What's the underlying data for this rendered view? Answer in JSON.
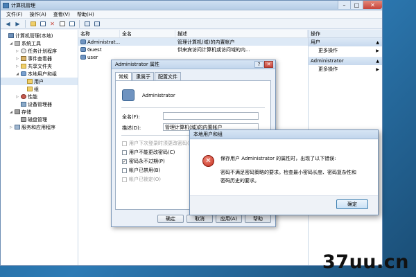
{
  "window": {
    "title": "计算机管理",
    "controls": {
      "min": "–",
      "max": "□",
      "close": "✕"
    }
  },
  "menu": [
    "文件(F)",
    "操作(A)",
    "查看(V)",
    "帮助(H)"
  ],
  "toolbar": {
    "back": "◀",
    "forward": "▶",
    "delete": "✕"
  },
  "tree": [
    {
      "label": "计算机管理(本地)",
      "indent": 0,
      "icon": "computer-icon",
      "exp": ""
    },
    {
      "label": "系统工具",
      "indent": 1,
      "icon": "tools-icon",
      "exp": "◢"
    },
    {
      "label": "任务计划程序",
      "indent": 2,
      "icon": "clock-icon",
      "exp": "▷"
    },
    {
      "label": "事件查看器",
      "indent": 2,
      "icon": "log-icon",
      "exp": "▷"
    },
    {
      "label": "共享文件夹",
      "indent": 2,
      "icon": "folder-icon",
      "exp": "▷"
    },
    {
      "label": "本地用户和组",
      "indent": 2,
      "icon": "users-icon",
      "exp": "◢"
    },
    {
      "label": "用户",
      "indent": 3,
      "icon": "folder-icon",
      "exp": ""
    },
    {
      "label": "组",
      "indent": 3,
      "icon": "folder-icon",
      "exp": ""
    },
    {
      "label": "性能",
      "indent": 2,
      "icon": "performance-icon",
      "exp": "▷"
    },
    {
      "label": "设备管理器",
      "indent": 2,
      "icon": "device-icon",
      "exp": ""
    },
    {
      "label": "存储",
      "indent": 1,
      "icon": "storage-icon",
      "exp": "◢"
    },
    {
      "label": "磁盘管理",
      "indent": 2,
      "icon": "disk-icon",
      "exp": ""
    },
    {
      "label": "服务和应用程序",
      "indent": 1,
      "icon": "services-icon",
      "exp": "▷"
    }
  ],
  "list": {
    "columns": [
      "名称",
      "全名",
      "描述"
    ],
    "rows": [
      {
        "name": "Administrat...",
        "fullname": "",
        "desc": "管理计算机(域)的内置帐户"
      },
      {
        "name": "Guest",
        "fullname": "",
        "desc": "供来宾访问计算机或访问域的内..."
      },
      {
        "name": "user",
        "fullname": "",
        "desc": ""
      }
    ]
  },
  "actions": {
    "header": "操作",
    "groups": [
      {
        "title": "用户",
        "item": "更多操作"
      },
      {
        "title": "Administrator",
        "item": "更多操作"
      }
    ]
  },
  "props_dialog": {
    "title": "Administrator 属性",
    "controls": {
      "help": "?",
      "close": "✕"
    },
    "tabs": [
      "常规",
      "隶属于",
      "配置文件"
    ],
    "username": "Administrator",
    "fullname_label": "全名(F):",
    "fullname_value": "",
    "desc_label": "描述(D):",
    "desc_value": "管理计算机(域)的内置帐户",
    "checkboxes": [
      {
        "label": "用户下次登录时须更改密码(M)",
        "checked": "",
        "disabled": true
      },
      {
        "label": "用户不能更改密码(C)",
        "checked": "",
        "disabled": false
      },
      {
        "label": "密码永不过期(P)",
        "checked": "✓",
        "disabled": false
      },
      {
        "label": "帐户已禁用(B)",
        "checked": "",
        "disabled": false
      },
      {
        "label": "帐户已锁定(O)",
        "checked": "",
        "disabled": true
      }
    ],
    "buttons": {
      "ok": "确定",
      "cancel": "取消",
      "apply": "应用(A)",
      "help": "帮助"
    }
  },
  "error_dialog": {
    "title": "本地用户和组",
    "icon": "✕",
    "message1": "保存用户 Administrator 的属性时，出现了以下错误:",
    "message2": "密码不满足密码策略的要求。检查最小密码长度、密码复杂性和密码历史的要求。",
    "ok": "确定"
  },
  "watermark": "37uu.cn"
}
